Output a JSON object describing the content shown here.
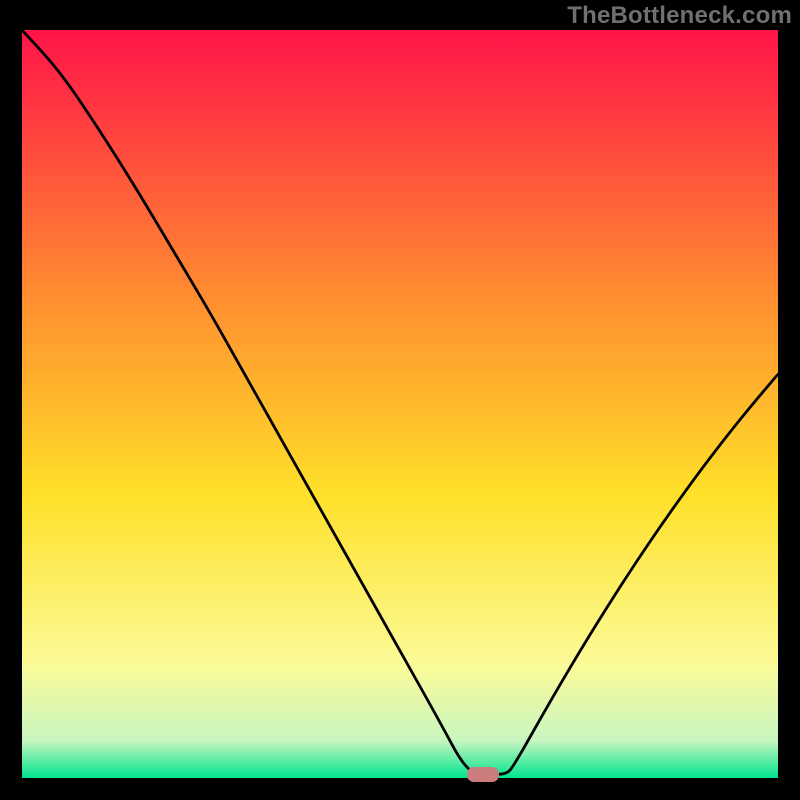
{
  "watermark": "TheBottleneck.com",
  "chart_data": {
    "type": "line",
    "title": "",
    "xlabel": "",
    "ylabel": "",
    "xlim": [
      0,
      100
    ],
    "ylim": [
      0,
      100
    ],
    "series": [
      {
        "name": "bottleneck-curve",
        "x": [
          0,
          5,
          10,
          15,
          20,
          25,
          30,
          35,
          40,
          45,
          50,
          55,
          59,
          62,
          64,
          65,
          70,
          75,
          80,
          85,
          90,
          95,
          100
        ],
        "values": [
          100,
          94.5,
          87,
          79,
          70.5,
          62,
          53,
          44,
          35,
          26,
          17,
          8,
          0.5,
          0.5,
          0.5,
          1.5,
          10.5,
          19,
          27,
          34.5,
          41.5,
          48,
          54
        ]
      }
    ],
    "marker": {
      "name": "optimal-point",
      "x": 61,
      "y": 0.5,
      "color": "#cb7d7e"
    },
    "gradient_colors": {
      "top": "#ff1449",
      "upper_mid": "#ff8b30",
      "mid": "#ffe029",
      "lower_mid": "#fbfb98",
      "bottom_band": "#c8f5c0",
      "bottom": "#00e58d"
    }
  }
}
